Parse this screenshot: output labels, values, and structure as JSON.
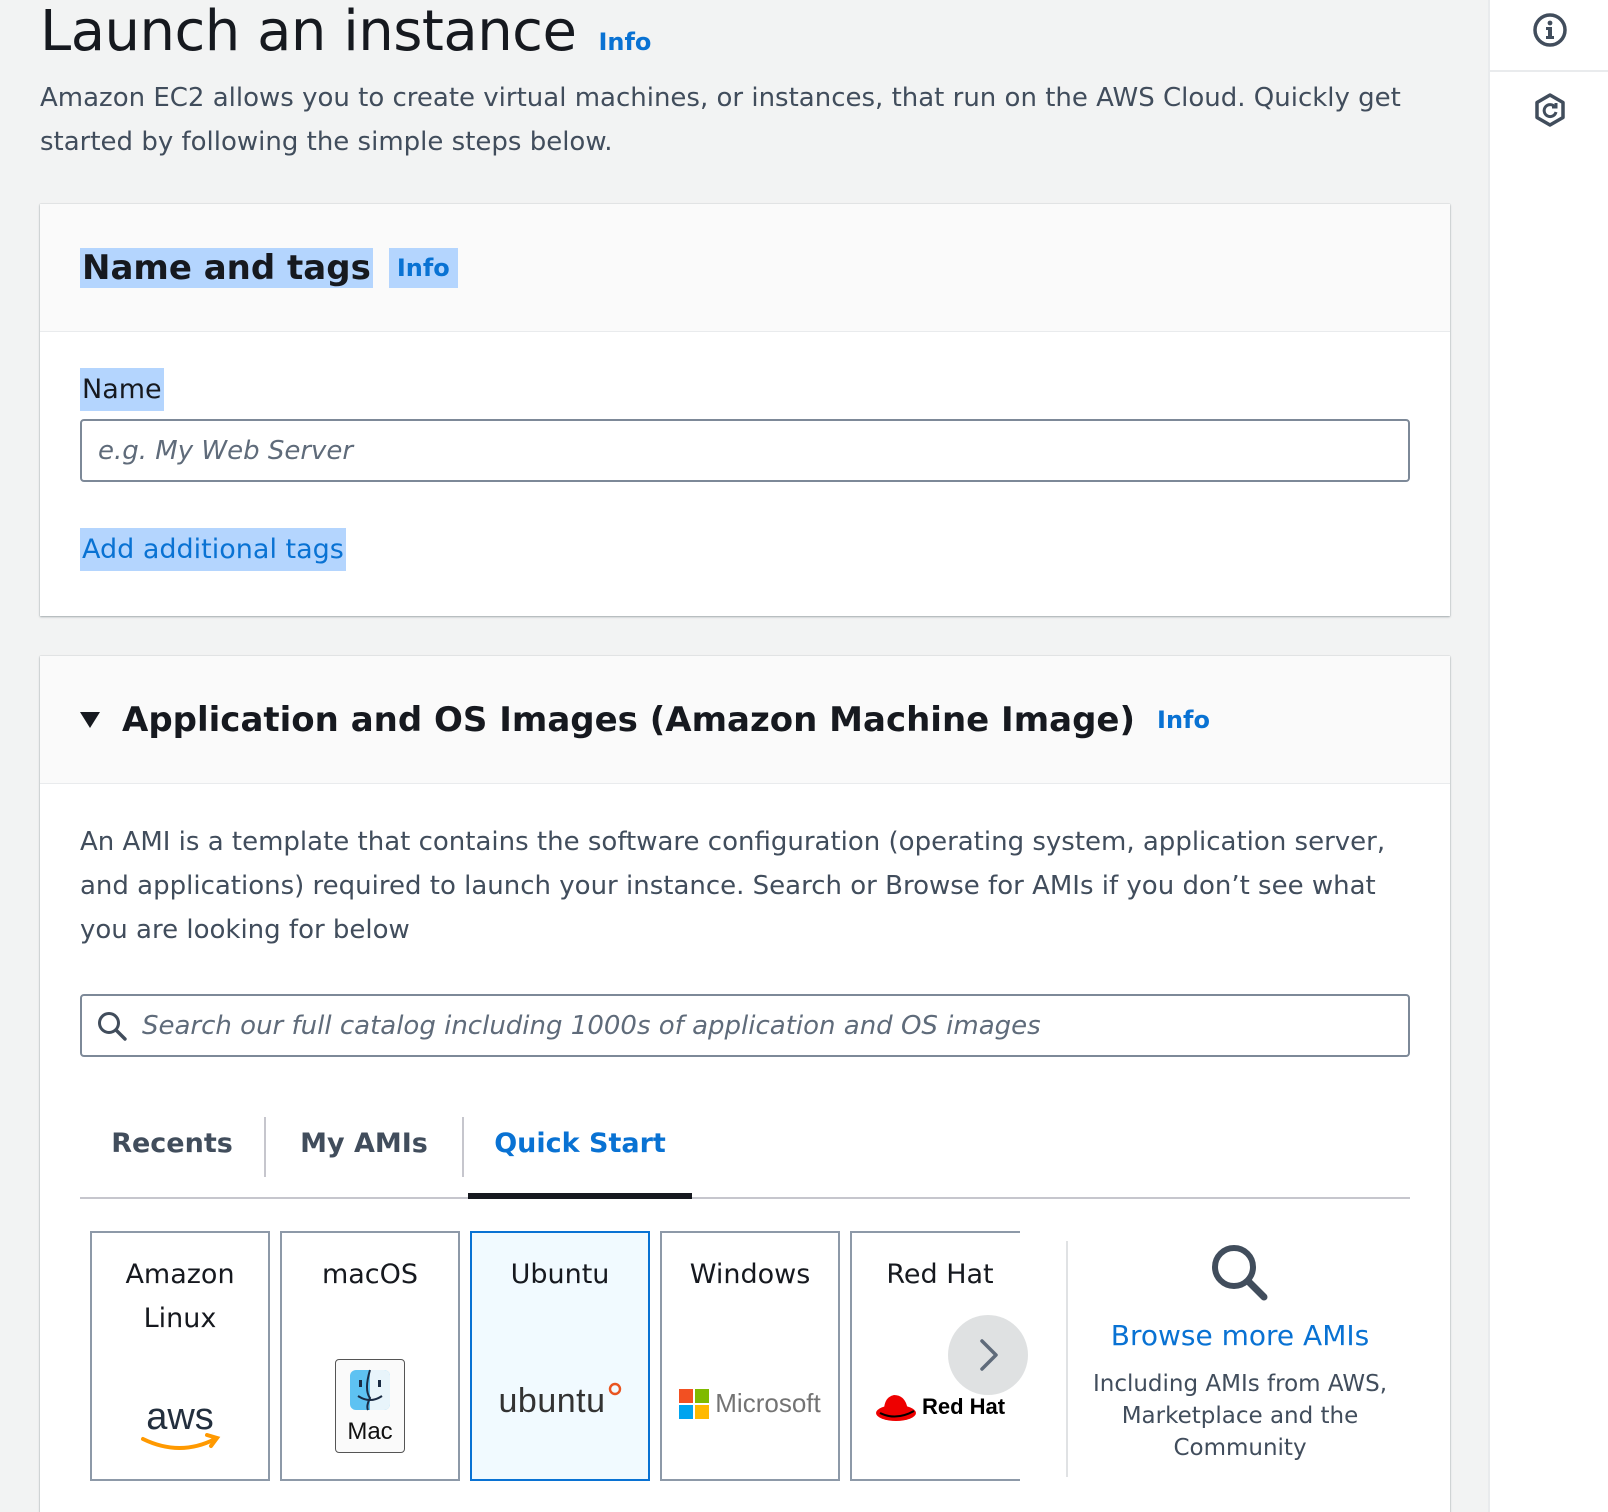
{
  "header": {
    "title": "Launch an instance",
    "info": "Info",
    "description": "Amazon EC2 allows you to create virtual machines, or instances, that run on the AWS Cloud. Quickly get started by following the simple steps below."
  },
  "name_tags": {
    "title": "Name and tags",
    "info": "Info",
    "name_label": "Name",
    "name_placeholder": "e.g. My Web Server",
    "add_tags": "Add additional tags"
  },
  "ami": {
    "title": "Application and OS Images (Amazon Machine Image)",
    "info": "Info",
    "description": "An AMI is a template that contains the software configuration (operating system, application server, and applications) required to launch your instance. Search or Browse for AMIs if you don’t see what you are looking for below",
    "search_placeholder": "Search our full catalog including 1000s of application and OS images",
    "tabs": [
      "Recents",
      "My AMIs",
      "Quick Start"
    ],
    "active_tab": "Quick Start",
    "tiles": [
      {
        "name": "Amazon Linux",
        "logo": "aws",
        "selected": false
      },
      {
        "name": "macOS",
        "logo": "Mac",
        "selected": false
      },
      {
        "name": "Ubuntu",
        "logo": "ubuntu",
        "selected": true
      },
      {
        "name": "Windows",
        "logo": "Microsoft",
        "selected": false
      },
      {
        "name": "Red Hat",
        "logo": "Red Hat",
        "selected": false
      }
    ],
    "browse": {
      "link": "Browse more AMIs",
      "subtext": "Including AMIs from AWS, Marketplace and the Community"
    }
  },
  "colors": {
    "accent": "#0972d3",
    "selection_highlight": "#b4d5fe",
    "selected_tile_bg": "#f1faff",
    "page_bg": "#f2f3f3"
  },
  "icons": {
    "rail": [
      "info-circle-icon",
      "hexagon-refresh-icon"
    ],
    "search": "search-icon",
    "next": "chevron-right-icon"
  }
}
